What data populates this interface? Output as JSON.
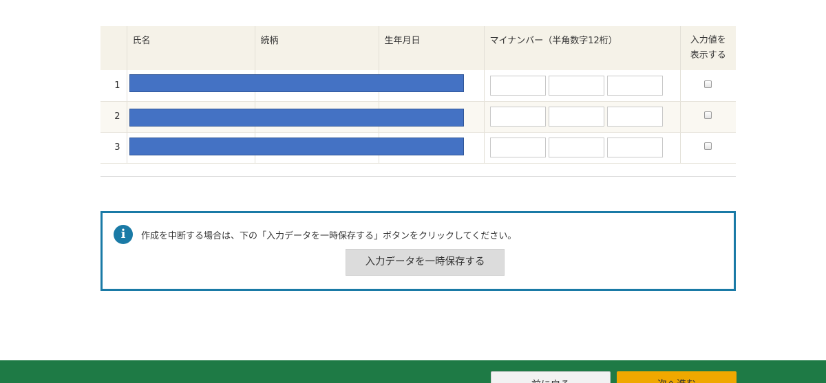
{
  "table": {
    "headers": {
      "index": "",
      "name": "氏名",
      "relationship": "続柄",
      "birthdate": "生年月日",
      "my_number": "マイナンバー（半角数字12桁）",
      "show_values_line1": "入力値を",
      "show_values_line2": "表示する"
    },
    "rows": [
      {
        "index": "1"
      },
      {
        "index": "2"
      },
      {
        "index": "3"
      }
    ]
  },
  "info": {
    "icon": "info-icon",
    "icon_glyph": "i",
    "message": "作成を中断する場合は、下の「入力データを一時保存する」ボタンをクリックしてください。",
    "save_label": "入力データを一時保存する"
  },
  "footer": {
    "back_label": "前に戻る",
    "next_label": "次へ進む"
  },
  "colors": {
    "accent": "#1a7aa6",
    "footer": "#1e7a45",
    "next_button": "#f0a800",
    "redaction": "#4472c4"
  }
}
